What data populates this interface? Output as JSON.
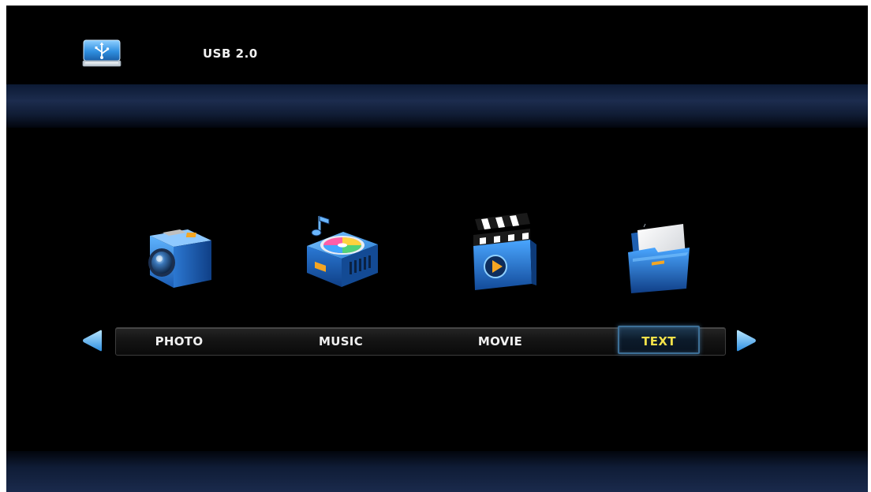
{
  "header": {
    "device_title": "USB 2.0",
    "device_icon": "usb-drive-icon"
  },
  "menu": {
    "items": [
      {
        "label": "PHOTO",
        "icon": "camera-icon",
        "selected": false
      },
      {
        "label": "MUSIC",
        "icon": "music-player-icon",
        "selected": false
      },
      {
        "label": "MOVIE",
        "icon": "clapperboard-icon",
        "selected": false
      },
      {
        "label": "TEXT",
        "icon": "document-folder-icon",
        "selected": true
      }
    ],
    "nav_left_icon": "left-arrow-icon",
    "nav_right_icon": "right-arrow-icon"
  },
  "colors": {
    "background": "#000000",
    "selected_text": "#f4e24a",
    "normal_text": "#f0f0f0",
    "accent_blue": "#2f8fe0",
    "selection_border": "#3d6f96"
  }
}
